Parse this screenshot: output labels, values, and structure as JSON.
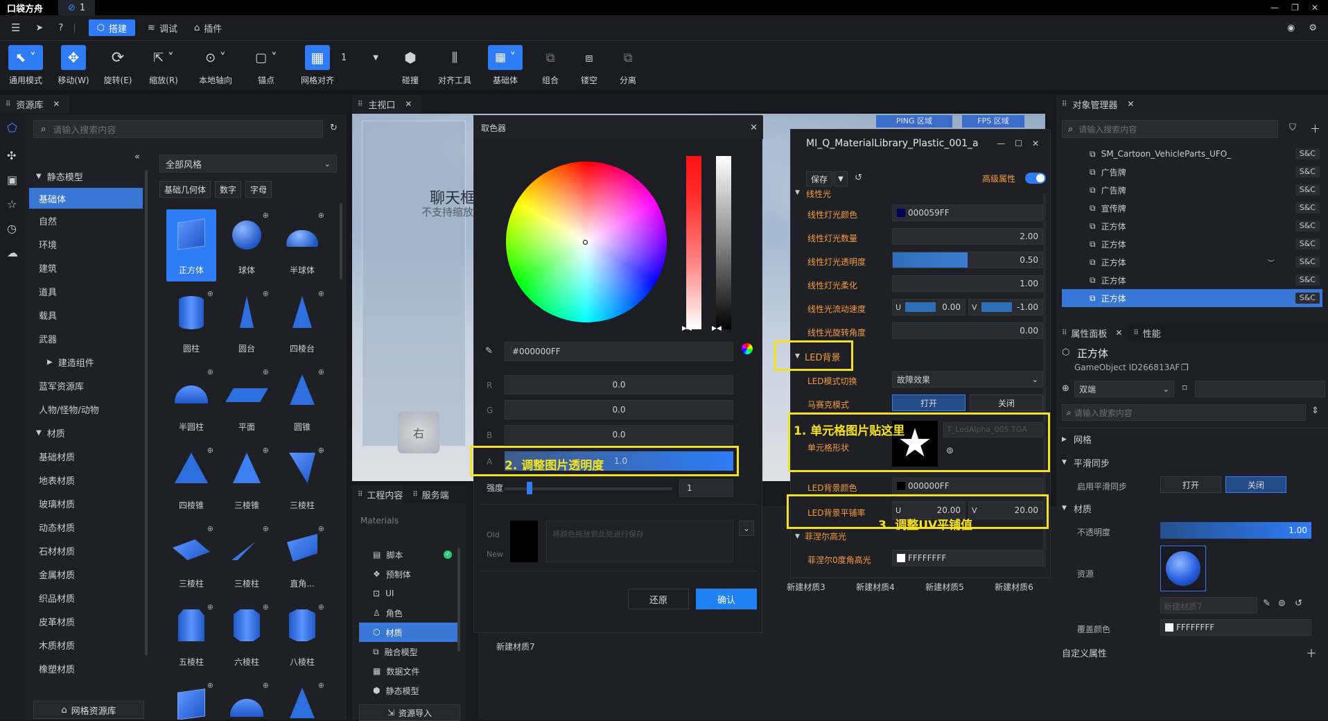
{
  "app": {
    "logo": "口袋方舟",
    "tab_label": "1"
  },
  "menu": {
    "tabs": [
      "搭建",
      "调试",
      "插件"
    ]
  },
  "toolbar": {
    "tools": [
      "通用模式",
      "移动(W)",
      "旋转(E)",
      "缩放(R)",
      "本地轴向",
      "锚点",
      "网格对齐",
      "碰撞",
      "对齐工具",
      "基础体",
      "组合",
      "镂空",
      "分离"
    ],
    "grid_value": "1"
  },
  "assets": {
    "tab": "资源库",
    "search_placeholder": "请输入搜索内容",
    "style_select": "全部风格",
    "filters": [
      "基础几何体",
      "数字",
      "字母"
    ],
    "tree": [
      "静态模型",
      "基础体",
      "自然",
      "环境",
      "建筑",
      "道具",
      "载具",
      "武器",
      "建造组件",
      "蓝军资源库",
      "人物/怪物/动物",
      "材质",
      "基础材质",
      "地表材质",
      "玻璃材质",
      "动态材质",
      "石材材质",
      "金属材质",
      "织品材质",
      "皮革材质",
      "木质材质",
      "橡塑材质"
    ],
    "items": [
      "正方体",
      "球体",
      "半球体",
      "圆柱",
      "圆台",
      "四棱台",
      "半圆柱",
      "平面",
      "圆锥",
      "四棱锥",
      "三棱锥",
      "三棱柱",
      "三棱柱",
      "三棱柱",
      "直角...",
      "五棱柱",
      "六棱柱",
      "八棱柱"
    ],
    "bottom_button": "网格资源库"
  },
  "viewport": {
    "tab": "主视口",
    "ping": "PING 区域",
    "fps": "FPS 区域",
    "chat_title": "聊天框",
    "chat_sub": "不支持缩放",
    "gizmo": "右"
  },
  "color_picker": {
    "title": "取色器",
    "hex": "#000000FF",
    "channels": [
      {
        "label": "R",
        "value": "0.0"
      },
      {
        "label": "G",
        "value": "0.0"
      },
      {
        "label": "B",
        "value": "0.0"
      },
      {
        "label": "A",
        "value": "1.0"
      }
    ],
    "intensity_label": "强度",
    "intensity_value": "1",
    "old_label": "Old",
    "new_label": "New",
    "save_hint": "将颜色拖放到此处进行保存",
    "reset": "还原",
    "confirm": "确认",
    "annotation": "2. 调整图片透明度"
  },
  "project": {
    "tabs": [
      "工程内容",
      "服务端"
    ],
    "header": "Materials",
    "items": [
      "脚本",
      "预制体",
      "UI",
      "角色",
      "材质",
      "融合模型",
      "数据文件",
      "静态模型"
    ],
    "import_button": "资源导入",
    "materials": [
      "新建材质3",
      "新建材质4",
      "新建材质5",
      "新建材质6"
    ],
    "extra_material": "新建材质7"
  },
  "material_editor": {
    "title": "MI_Q_MaterialLibrary_Plastic_001_a",
    "save": "保存",
    "advanced": "高级属性",
    "section_top": "线性光",
    "props": [
      {
        "label": "线性灯光颜色",
        "value": "000059FF"
      },
      {
        "label": "线性灯光数量",
        "value": "2.00"
      },
      {
        "label": "线性灯光透明度",
        "value": "0.50"
      },
      {
        "label": "线性灯光柔化",
        "value": "1.00"
      },
      {
        "label": "线性光流动速度",
        "u": "0.00",
        "v": "-1.00"
      },
      {
        "label": "线性光旋转角度",
        "value": "0.00"
      }
    ],
    "led_section": "LED背景",
    "led_mode_label": "LED模式切换",
    "led_mode_value": "故障效果",
    "mosaic_label": "马赛克模式",
    "mosaic_on": "打开",
    "mosaic_off": "关闭",
    "cell_shape_label": "单元格形状",
    "cell_texture": "T_LedAlpha_005.TGA",
    "annotation1": "1. 单元格图片贴这里",
    "bg_color_label": "LED背景颜色",
    "bg_color_value": "000000FF",
    "tiling_label": "LED背景平铺率",
    "tiling_u": "20.00",
    "tiling_v": "20.00",
    "annotation3": "3. 调整UV平铺值",
    "fresnel_section": "菲涅尔高光",
    "fresnel_label": "菲涅尔0度角高光",
    "fresnel_value": "FFFFFFFF",
    "uv_u": "U",
    "uv_v": "V"
  },
  "object_manager": {
    "tab": "对象管理器",
    "search_placeholder": "请输入搜索内容",
    "items": [
      {
        "name": "SM_Cartoon_VehicleParts_UFO_",
        "tag": "S&C"
      },
      {
        "name": "广告牌",
        "tag": "S&C"
      },
      {
        "name": "广告牌",
        "tag": "S&C"
      },
      {
        "name": "宣传牌",
        "tag": "S&C"
      },
      {
        "name": "正方体",
        "tag": "S&C"
      },
      {
        "name": "正方体",
        "tag": "S&C"
      },
      {
        "name": "正方体",
        "tag": "S&C"
      },
      {
        "name": "正方体",
        "tag": "S&C"
      },
      {
        "name": "正方体",
        "tag": "S&C"
      }
    ]
  },
  "properties": {
    "tabs": [
      "属性面板",
      "性能"
    ],
    "object_name": "正方体",
    "object_id": "GameObject ID266813AF",
    "network": "双端",
    "search_placeholder": "请输入搜索内容",
    "sections": [
      "网格",
      "平滑同步",
      "材质",
      "自定义属性"
    ],
    "smooth_label": "启用平滑同步",
    "smooth_on": "打开",
    "smooth_off": "关闭",
    "opacity_label": "不透明度",
    "opacity_value": "1.00",
    "opacity_fraction": 1.0,
    "resource_label": "资源",
    "resource_name": "新建材质7",
    "cover_label": "覆盖颜色",
    "cover_value": "FFFFFFFF"
  }
}
